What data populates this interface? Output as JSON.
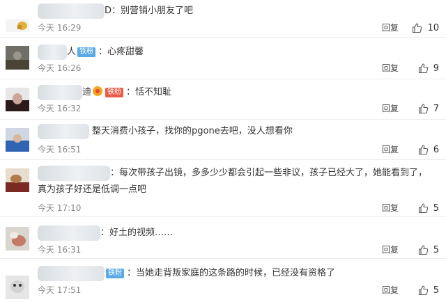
{
  "comments": [
    {
      "name_suffix": "D",
      "separator": "：",
      "text": "别营销小朋友了吧",
      "time": "今天 16:29",
      "reply": "回复",
      "likes": "10"
    },
    {
      "name_suffix": "人",
      "badge": "铁粉",
      "separator": "：",
      "text": "心疼甜馨",
      "time": "今天 16:26",
      "reply": "回复",
      "likes": "9"
    },
    {
      "name_suffix": "迪",
      "badge": "铁粉",
      "separator": "：",
      "text": "恬不知耻",
      "time": "今天 16:32",
      "reply": "回复",
      "likes": "7"
    },
    {
      "text": "整天消费小孩子，找你的pgone去吧，没人想看你",
      "time": "今天 16:51",
      "reply": "回复",
      "likes": "6"
    },
    {
      "separator": "：",
      "text": "每次带孩子出镜，多多少少都会引起一些非议，孩子已经大了，她能看到了，",
      "text2": "真为孩子好还是低调一点吧",
      "time": "今天 17:10",
      "reply": "回复",
      "likes": "5"
    },
    {
      "separator": "：",
      "text": "好土的视频……",
      "time": "今天 16:31",
      "reply": "回复",
      "likes": "5"
    },
    {
      "badge": "铁粉",
      "separator": "：",
      "text": "当她走背叛家庭的这条路的时候，已经没有资格了",
      "time": "今天 17:51",
      "reply": "回复",
      "likes": "5"
    }
  ],
  "colors": {
    "badge": "#5aa9e6",
    "text": "#333333",
    "meta": "#888888"
  },
  "icons": {
    "like": "thumbs-up-icon"
  }
}
